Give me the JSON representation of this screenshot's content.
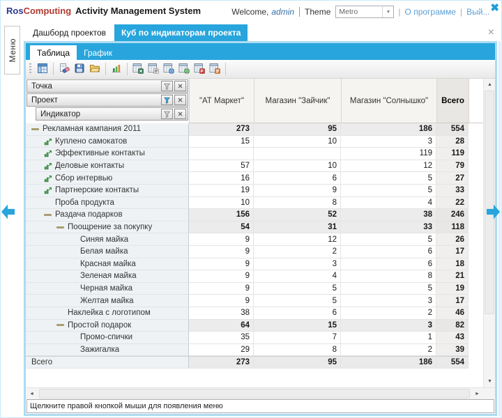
{
  "header": {
    "brand_primary": "Ros",
    "brand_secondary": "Computing",
    "app_title": "Activity Management System",
    "welcome_label": "Welcome,",
    "username": "admin",
    "theme_label": "Theme",
    "theme_value": "Metro",
    "about_link": "О программе",
    "logout_link": "Вый..."
  },
  "menu_tab_label": "Меню",
  "tabs": [
    {
      "name": "dashboard",
      "label": "Дашборд проектов",
      "active": false
    },
    {
      "name": "cube",
      "label": "Куб по индикаторам проекта",
      "active": true
    }
  ],
  "subtabs": [
    {
      "name": "table",
      "label": "Таблица",
      "active": true
    },
    {
      "name": "chart",
      "label": "График",
      "active": false
    }
  ],
  "toolbar": {
    "buttons": [
      "pivot-layout-icon",
      "sep",
      "clear-layout-icon",
      "save-layout-icon",
      "open-layout-icon",
      "sep",
      "chart-icon",
      "sep",
      "export-xls-icon",
      "export-txt-icon",
      "export-mht-icon",
      "export-html-icon",
      "export-pdf-icon",
      "export-rtf-icon",
      "sep"
    ]
  },
  "pivot": {
    "fields": [
      {
        "name": "point",
        "label": "Точка",
        "filter_active": false,
        "indent": 0
      },
      {
        "name": "project",
        "label": "Проект",
        "filter_active": true,
        "indent": 0
      },
      {
        "name": "indicator",
        "label": "Индикатор",
        "filter_active": false,
        "indent": 1
      }
    ],
    "columns": [
      "\"АТ Маркет\"",
      "Магазин \"Зайчик\"",
      "Магазин \"Солнышко\"",
      "Всего"
    ],
    "rows": [
      {
        "label": "Рекламная кампания 2011",
        "level": 0,
        "kind": "group",
        "icon": null,
        "values": [
          "273",
          "95",
          "186",
          "554"
        ]
      },
      {
        "label": "Куплено самокатов",
        "level": 1,
        "kind": "leaf",
        "icon": "kpi-icon",
        "values": [
          "15",
          "10",
          "3",
          "28"
        ]
      },
      {
        "label": "Эффективные контакты",
        "level": 1,
        "kind": "leaf",
        "icon": "kpi-icon",
        "values": [
          "",
          "",
          "119",
          "119"
        ]
      },
      {
        "label": "Деловые контакты",
        "level": 1,
        "kind": "leaf",
        "icon": "kpi-icon",
        "values": [
          "57",
          "10",
          "12",
          "79"
        ]
      },
      {
        "label": "Сбор интервью",
        "level": 1,
        "kind": "leaf",
        "icon": "kpi-icon",
        "values": [
          "16",
          "6",
          "5",
          "27"
        ]
      },
      {
        "label": "Партнерские контакты",
        "level": 1,
        "kind": "leaf",
        "icon": "kpi-icon",
        "values": [
          "19",
          "9",
          "5",
          "33"
        ]
      },
      {
        "label": "Проба продукта",
        "level": 1,
        "kind": "leaf",
        "icon": null,
        "values": [
          "10",
          "8",
          "4",
          "22"
        ]
      },
      {
        "label": "Раздача подарков",
        "level": 1,
        "kind": "group",
        "icon": null,
        "values": [
          "156",
          "52",
          "38",
          "246"
        ]
      },
      {
        "label": "Поощрение за покупку",
        "level": 2,
        "kind": "group",
        "icon": null,
        "values": [
          "54",
          "31",
          "33",
          "118"
        ]
      },
      {
        "label": "Синяя майка",
        "level": 3,
        "kind": "leaf",
        "icon": null,
        "values": [
          "9",
          "12",
          "5",
          "26"
        ]
      },
      {
        "label": "Белая майка",
        "level": 3,
        "kind": "leaf",
        "icon": null,
        "values": [
          "9",
          "2",
          "6",
          "17"
        ]
      },
      {
        "label": "Красная майка",
        "level": 3,
        "kind": "leaf",
        "icon": null,
        "values": [
          "9",
          "3",
          "6",
          "18"
        ]
      },
      {
        "label": "Зеленая майка",
        "level": 3,
        "kind": "leaf",
        "icon": null,
        "values": [
          "9",
          "4",
          "8",
          "21"
        ]
      },
      {
        "label": "Черная майка",
        "level": 3,
        "kind": "leaf",
        "icon": null,
        "values": [
          "9",
          "5",
          "5",
          "19"
        ]
      },
      {
        "label": "Желтая майка",
        "level": 3,
        "kind": "leaf",
        "icon": null,
        "values": [
          "9",
          "5",
          "3",
          "17"
        ]
      },
      {
        "label": "Наклейка с логотипом",
        "level": 2,
        "kind": "leaf",
        "icon": null,
        "values": [
          "38",
          "6",
          "2",
          "46"
        ]
      },
      {
        "label": "Простой подарок",
        "level": 2,
        "kind": "group",
        "icon": null,
        "values": [
          "64",
          "15",
          "3",
          "82"
        ]
      },
      {
        "label": "Промо-спички",
        "level": 3,
        "kind": "leaf",
        "icon": null,
        "values": [
          "35",
          "7",
          "1",
          "43"
        ]
      },
      {
        "label": "Зажигалка",
        "level": 3,
        "kind": "leaf",
        "icon": null,
        "values": [
          "29",
          "8",
          "2",
          "39"
        ]
      },
      {
        "label": "Всего",
        "level": 0,
        "kind": "grand",
        "icon": null,
        "values": [
          "273",
          "95",
          "186",
          "554"
        ]
      }
    ]
  },
  "statusbar": {
    "text": "Щелкните правой кнопкой мыши для появления меню"
  },
  "colors": {
    "accent_blue": "#27A5DC",
    "panel_border": "#ABDBF2",
    "link_blue": "#5C9FD6",
    "brand_blue": "#2B3990",
    "brand_red": "#B03A30"
  }
}
